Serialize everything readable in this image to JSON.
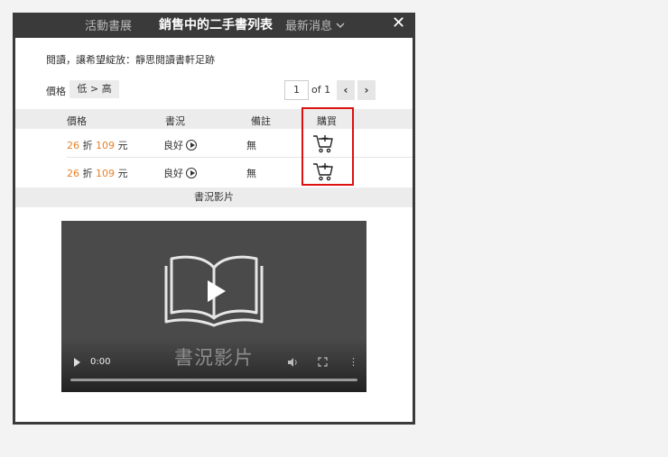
{
  "topbar": {
    "left_tab": "活動書展",
    "title": "銷售中的二手書列表",
    "right_tab": "最新消息",
    "close": "✕"
  },
  "subtitle": "閱讀，讓希望綻放：靜思閱讀書軒足跡",
  "sort": {
    "label": "價格",
    "value": "低 > 高"
  },
  "pagination": {
    "current": "1",
    "of_text": "of 1",
    "prev": "‹",
    "next": "›"
  },
  "table": {
    "headers": [
      "價格",
      "書況",
      "備註",
      "購買"
    ],
    "rows": [
      {
        "discount": "26",
        "discount_unit": "折",
        "price": "109",
        "price_unit": "元",
        "condition": "良好",
        "note": "無"
      },
      {
        "discount": "26",
        "discount_unit": "折",
        "price": "109",
        "price_unit": "元",
        "condition": "良好",
        "note": "無"
      }
    ]
  },
  "video_section": {
    "header": "書況影片",
    "overlay_title": "書況影片",
    "time": "0:00",
    "more": "⋮"
  },
  "icons": {
    "cart": "cart-plus-icon",
    "play": "play-circle-icon",
    "book": "open-book-icon",
    "volume": "volume-icon",
    "fullscreen": "fullscreen-icon"
  },
  "colors": {
    "price_accent": "#e8812a",
    "highlight": "#dd1111",
    "header_bar": "#3a3a3a"
  }
}
